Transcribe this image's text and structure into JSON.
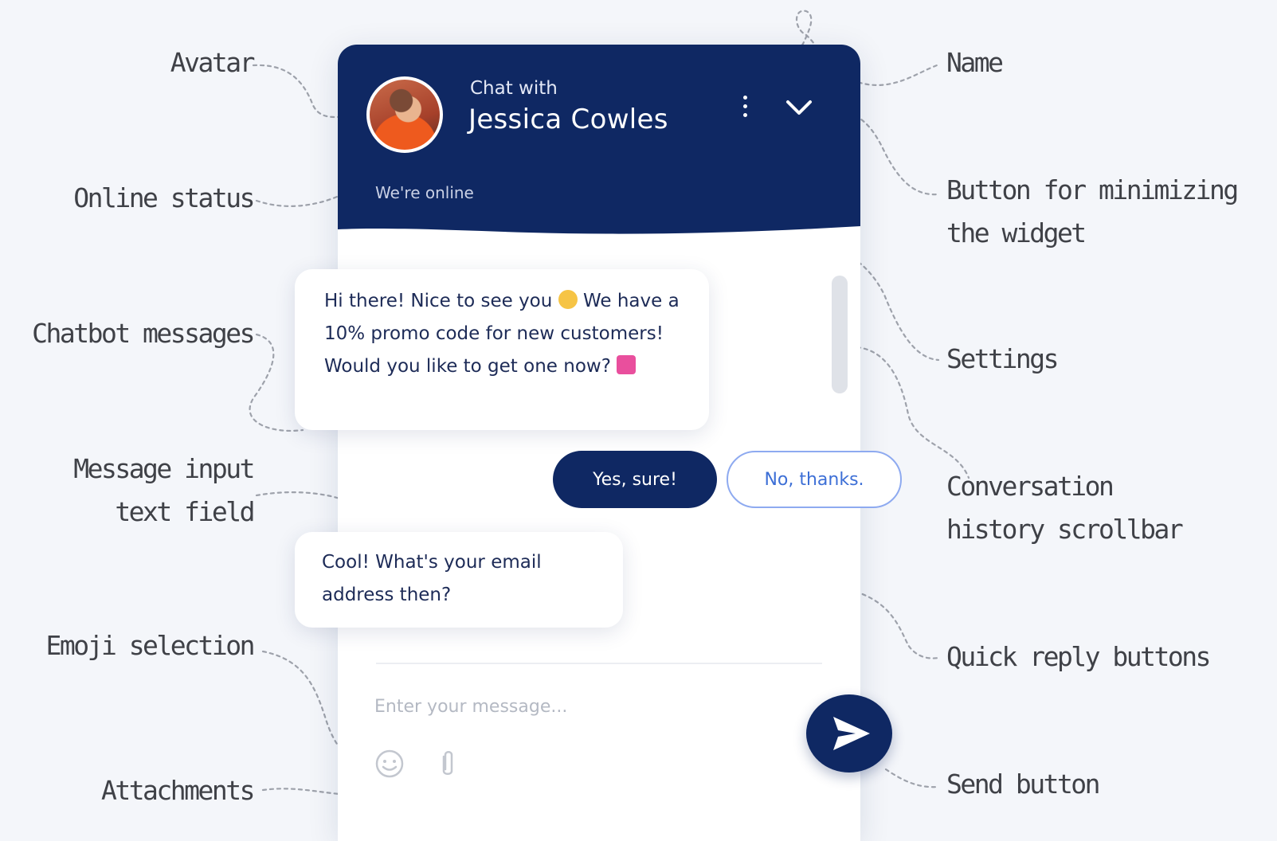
{
  "annotations": {
    "avatar": "Avatar",
    "online_status": "Online status",
    "chatbot_messages": "Chatbot messages",
    "message_input_line1": "Message input",
    "message_input_line2": "text field",
    "emoji_selection": "Emoji selection",
    "attachments": "Attachments",
    "name": "Name",
    "minimize_line1": "Button for minimizing",
    "minimize_line2": "the widget",
    "settings": "Settings",
    "scrollbar_line1": "Conversation",
    "scrollbar_line2": "history scrollbar",
    "quick_reply": "Quick reply buttons",
    "send_button": "Send button"
  },
  "widget": {
    "header": {
      "chat_with": "Chat with",
      "agent_name": "Jessica Cowles",
      "status": "We're online",
      "color": "#0f2863"
    },
    "messages": [
      {
        "from": "bot",
        "text_a": "Hi there! Nice to see you",
        "text_b": "We have a 10% promo code for new customers! Would you like to get one now?"
      },
      {
        "from": "bot",
        "text": "Cool! What's your email address then?"
      }
    ],
    "quick_replies": {
      "yes": "Yes, sure!",
      "no": "No, thanks."
    },
    "input": {
      "placeholder": "Enter your message..."
    },
    "icons": {
      "settings": "kebab-icon",
      "minimize": "chevron-down-icon",
      "emoji": "smiley-icon",
      "attach": "paperclip-icon",
      "send": "send-arrow-icon"
    },
    "accent_color": "#0f2863",
    "link_color": "#3d6fd6"
  }
}
